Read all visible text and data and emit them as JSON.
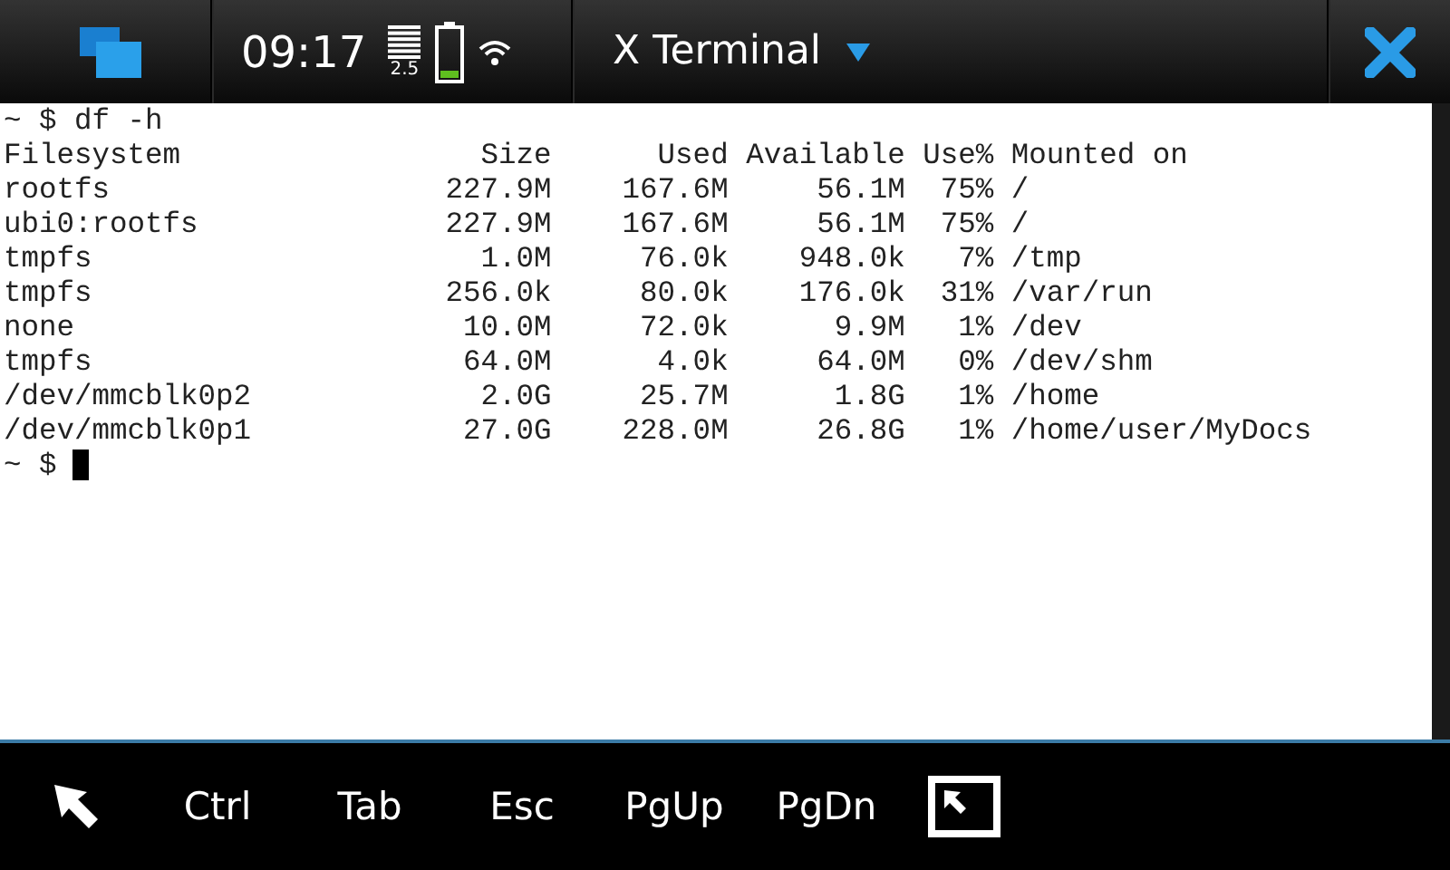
{
  "status_bar": {
    "time": "09:17",
    "signal_label": "2.5",
    "title": "X Terminal"
  },
  "terminal": {
    "lines": [
      "~ $ df -h",
      "Filesystem                 Size      Used Available Use% Mounted on",
      "rootfs                   227.9M    167.6M     56.1M  75% /",
      "ubi0:rootfs              227.9M    167.6M     56.1M  75% /",
      "tmpfs                      1.0M     76.0k    948.0k   7% /tmp",
      "tmpfs                    256.0k     80.0k    176.0k  31% /var/run",
      "none                      10.0M     72.0k      9.9M   1% /dev",
      "tmpfs                     64.0M      4.0k     64.0M   0% /dev/shm",
      "/dev/mmcblk0p2             2.0G     25.7M      1.8G   1% /home",
      "/dev/mmcblk0p1            27.0G    228.0M     26.8G   1% /home/user/MyDocs"
    ],
    "prompt": "~ $"
  },
  "toolbar": {
    "keys": [
      "Ctrl",
      "Tab",
      "Esc",
      "PgUp",
      "PgDn"
    ]
  }
}
